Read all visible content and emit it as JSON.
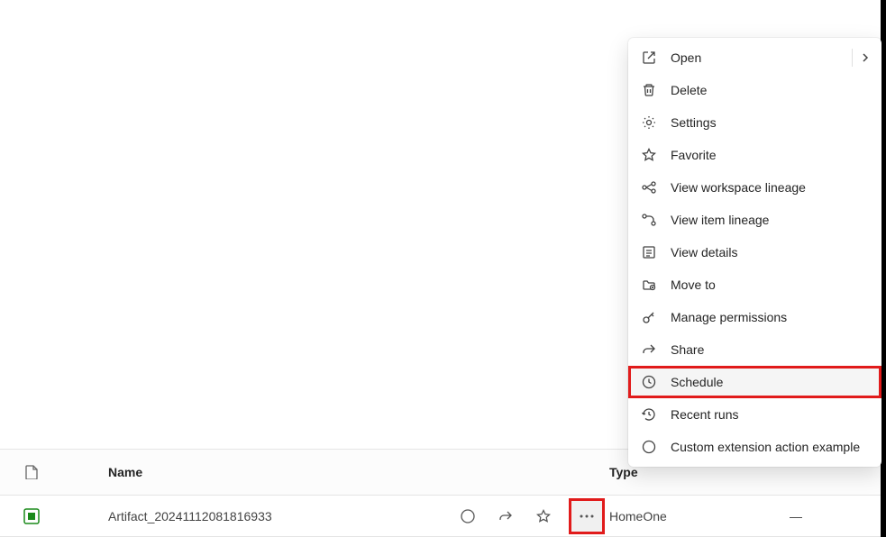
{
  "list": {
    "header": {
      "name": "Name",
      "type": "Type"
    },
    "row": {
      "name": "Artifact_20241112081816933",
      "type": "HomeOne",
      "extra": "—"
    }
  },
  "menu": {
    "items": [
      {
        "label": "Open",
        "icon": "open",
        "chevron": true
      },
      {
        "label": "Delete",
        "icon": "delete"
      },
      {
        "label": "Settings",
        "icon": "settings"
      },
      {
        "label": "Favorite",
        "icon": "favorite"
      },
      {
        "label": "View workspace lineage",
        "icon": "lineage"
      },
      {
        "label": "View item lineage",
        "icon": "lineage2"
      },
      {
        "label": "View details",
        "icon": "details"
      },
      {
        "label": "Move to",
        "icon": "moveto"
      },
      {
        "label": "Manage permissions",
        "icon": "permissions"
      },
      {
        "label": "Share",
        "icon": "share"
      },
      {
        "label": "Schedule",
        "icon": "schedule",
        "highlighted": true
      },
      {
        "label": "Recent runs",
        "icon": "recent"
      },
      {
        "label": "Custom extension action example",
        "icon": "custom"
      }
    ]
  }
}
